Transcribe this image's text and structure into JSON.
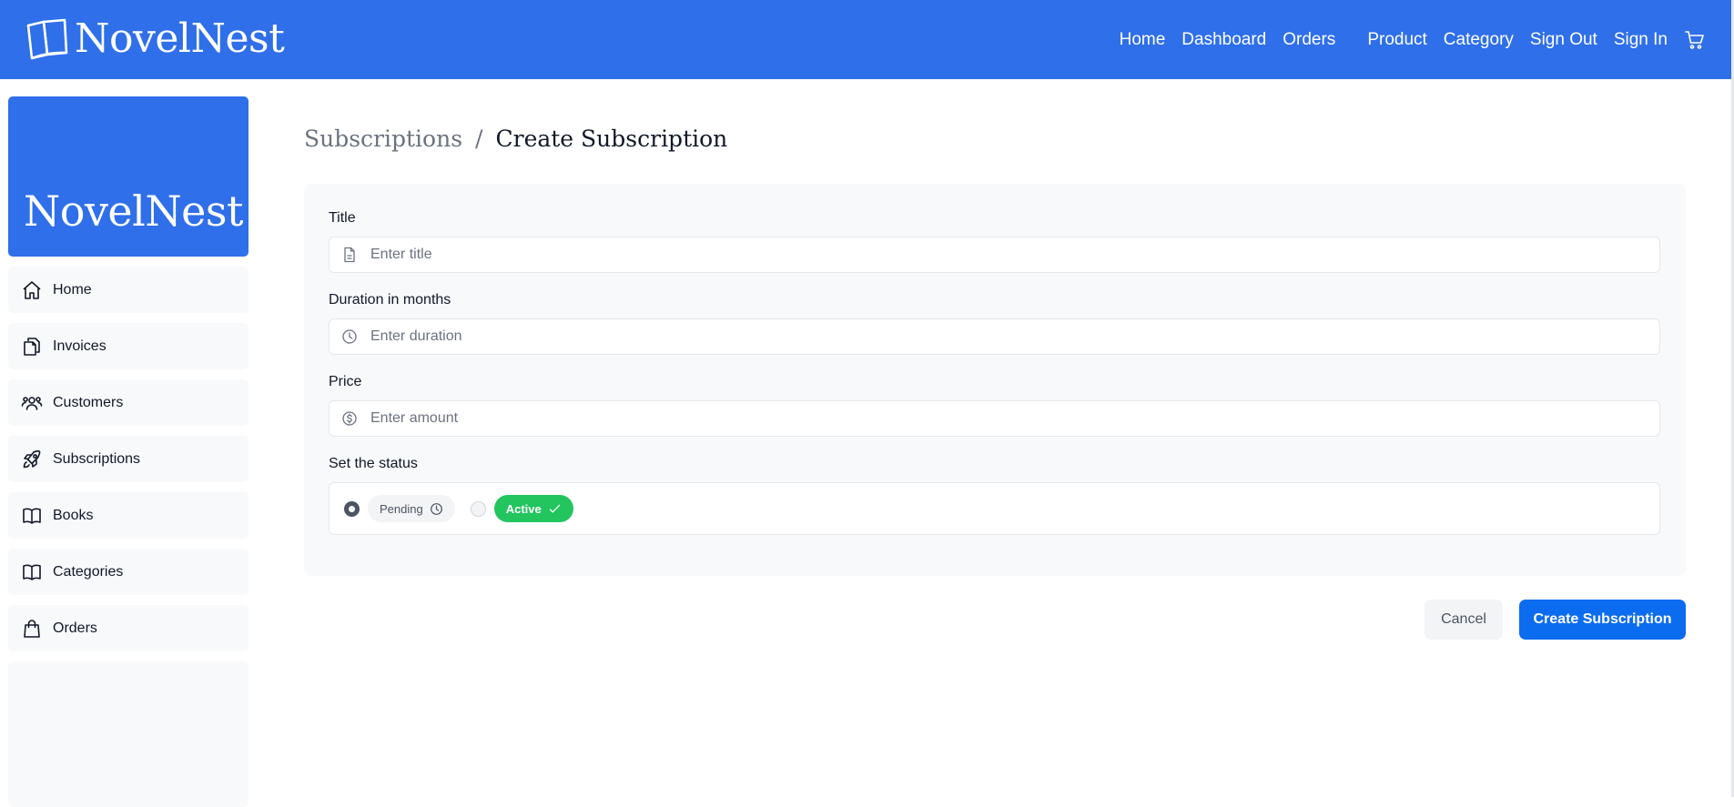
{
  "brand": {
    "name": "NovelNest",
    "icon": "open-book-icon"
  },
  "topnav": {
    "items": [
      {
        "label": "Home"
      },
      {
        "label": "Dashboard"
      },
      {
        "label": "Orders"
      },
      {
        "label": "Product"
      },
      {
        "label": "Category"
      },
      {
        "label": "Sign Out"
      },
      {
        "label": "Sign In"
      }
    ],
    "cart_icon": "cart-icon"
  },
  "sidebar": {
    "logo_text": "NovelNest",
    "items": [
      {
        "label": "Home",
        "icon": "home-icon"
      },
      {
        "label": "Invoices",
        "icon": "documents-icon"
      },
      {
        "label": "Customers",
        "icon": "users-icon"
      },
      {
        "label": "Subscriptions",
        "icon": "rocket-icon"
      },
      {
        "label": "Books",
        "icon": "book-icon"
      },
      {
        "label": "Categories",
        "icon": "book-icon"
      },
      {
        "label": "Orders",
        "icon": "shopping-bag-icon"
      }
    ]
  },
  "breadcrumb": {
    "parent": "Subscriptions",
    "separator": "/",
    "current": "Create Subscription"
  },
  "form": {
    "title": {
      "label": "Title",
      "value": "",
      "placeholder": "Enter title",
      "icon": "document-icon"
    },
    "duration": {
      "label": "Duration in months",
      "value": "",
      "placeholder": "Enter duration",
      "icon": "clock-icon"
    },
    "price": {
      "label": "Price",
      "value": "",
      "placeholder": "Enter amount",
      "icon": "dollar-icon"
    },
    "status": {
      "label": "Set the status",
      "selected": "pending",
      "options": [
        {
          "value": "pending",
          "label": "Pending",
          "icon": "clock-icon"
        },
        {
          "value": "active",
          "label": "Active",
          "icon": "check-icon"
        }
      ]
    }
  },
  "actions": {
    "cancel_label": "Cancel",
    "submit_label": "Create Subscription"
  },
  "colors": {
    "brand_blue": "#2f6fe9",
    "primary_button": "#0b6cf0",
    "active_green": "#22c55e",
    "panel_bg": "#f8f9fb"
  }
}
